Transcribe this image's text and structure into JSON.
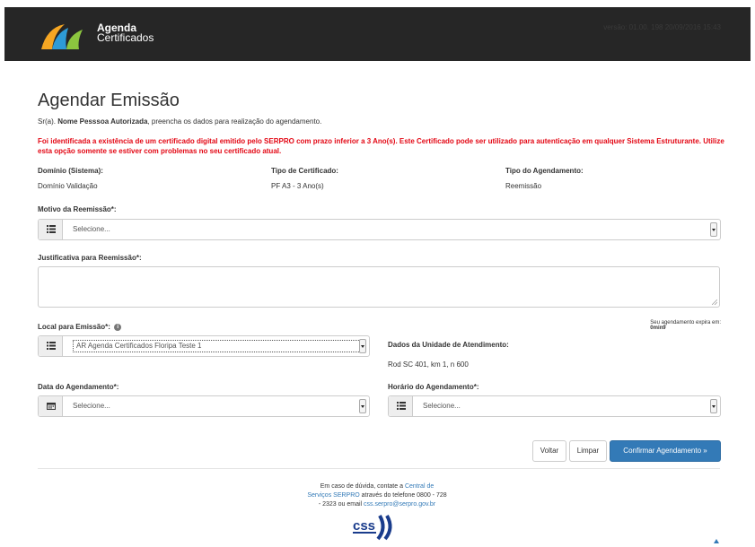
{
  "header": {
    "brand_line1": "Agenda",
    "brand_line2": "Certificados",
    "version": "versão: 01.00. 198 20/09/2016 15:43"
  },
  "page": {
    "title": "Agendar Emissão",
    "intro_prefix": "Sr(a).",
    "intro_name": "Nome Pesssoa Autorizada",
    "intro_suffix": ", preencha os dados para realização do agendamento.",
    "warning": "Foi identificada a existência de um certificado digital emitido pelo SERPRO com prazo inferior a 3 Ano(s). Este Certificado pode ser utilizado para autenticação em qualquer Sistema Estruturante. Utilize esta opção somente se estiver com problemas no seu certificado atual."
  },
  "summary": {
    "dominio_label": "Domínio (Sistema):",
    "dominio_value": "Domínio Validação",
    "tipo_cert_label": "Tipo de Certificado:",
    "tipo_cert_value": "PF A3 - 3 Ano(s)",
    "tipo_agend_label": "Tipo do Agendamento:",
    "tipo_agend_value": "Reemissão"
  },
  "form": {
    "motivo_label": "Motivo da Reemissão*:",
    "motivo_value": "Selecione...",
    "justificativa_label": "Justificativa para Reemissão*:",
    "local_label": "Local para Emissão*:",
    "local_value": "AR Agenda Certificados Floripa Teste 1",
    "expire_text": "Seu agendamento expira em:",
    "expire_time": "0min9",
    "unidade_label": "Dados da Unidade de Atendimento:",
    "unidade_endereco": "Rod SC 401, km 1, n 600",
    "data_label": "Data do Agendamento*:",
    "data_value": "Selecione...",
    "horario_label": "Horário do Agendamento*:",
    "horario_value": "Selecione..."
  },
  "buttons": {
    "voltar": "Voltar",
    "limpar": "Limpar",
    "confirmar": "Confirmar Agendamento »"
  },
  "footer": {
    "text1": "Em caso de dúvida, contate a",
    "link1": "Central de",
    "link1b": "Serviços SERPRO",
    "text2": "através do telefone 0800 - 728",
    "text3": "- 2323 ou email",
    "email": "css.serpro@serpro.gov.br",
    "logo_text": "css"
  },
  "icons": {
    "list": "list-icon",
    "calendar": "calendar-icon",
    "info": "info-icon"
  }
}
